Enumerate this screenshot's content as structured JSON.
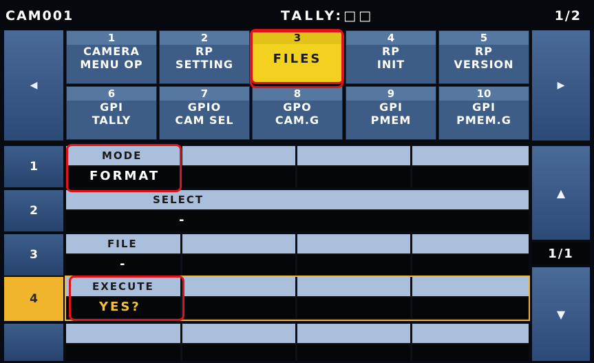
{
  "status": {
    "camera": "CAM001",
    "tally": "TALLY:□□",
    "page": "1/2"
  },
  "nav": {
    "left_icon": "◀",
    "right_icon": "▶"
  },
  "tabs": [
    {
      "num": "1",
      "l1": "CAMERA",
      "l2": "MENU OP"
    },
    {
      "num": "2",
      "l1": "RP",
      "l2": "SETTING"
    },
    {
      "num": "3",
      "l1": "FILES",
      "l2": ""
    },
    {
      "num": "4",
      "l1": "RP",
      "l2": "INIT"
    },
    {
      "num": "5",
      "l1": "RP",
      "l2": "VERSION"
    },
    {
      "num": "6",
      "l1": "GPI",
      "l2": "TALLY"
    },
    {
      "num": "7",
      "l1": "GPIO",
      "l2": "CAM SEL"
    },
    {
      "num": "8",
      "l1": "GPO",
      "l2": "CAM.G"
    },
    {
      "num": "9",
      "l1": "GPI",
      "l2": "PMEM"
    },
    {
      "num": "10",
      "l1": "GPI",
      "l2": "PMEM.G"
    }
  ],
  "rows": [
    {
      "num": "1",
      "label": "MODE",
      "value": "FORMAT"
    },
    {
      "num": "2",
      "label": "SELECT",
      "value": "-"
    },
    {
      "num": "3",
      "label": "FILE",
      "value": "-"
    },
    {
      "num": "4",
      "label": "EXECUTE",
      "value": "YES?"
    }
  ],
  "list": {
    "up_icon": "▲",
    "down_icon": "▼",
    "pager": "1/1"
  },
  "colors": {
    "selected_tab": "#f2d21f",
    "highlight": "#e0131b",
    "active_row": "#f0b52c"
  }
}
